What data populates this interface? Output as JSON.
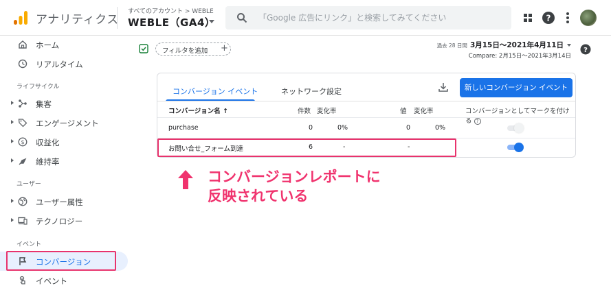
{
  "header": {
    "app_name": "アナリティクス",
    "account_path": "すべてのアカウント > WEBLE",
    "property_name": "WEBLE（GA4）",
    "search_placeholder": "「Google 広告にリンク」と検索してみてください",
    "icons": [
      "apps-grid-icon",
      "help-icon",
      "more-vert-icon",
      "avatar"
    ]
  },
  "sidebar": {
    "items": [
      {
        "label": "ホーム",
        "icon": "home-icon"
      },
      {
        "label": "リアルタイム",
        "icon": "clock-icon"
      }
    ],
    "section_lifecycle": "ライフサイクル",
    "lifecycle_items": [
      {
        "label": "集客",
        "icon": "acquisition-icon"
      },
      {
        "label": "エンゲージメント",
        "icon": "engagement-tag-icon"
      },
      {
        "label": "収益化",
        "icon": "dollar-circle-icon"
      },
      {
        "label": "維持率",
        "icon": "retention-icon"
      }
    ],
    "section_user": "ユーザー",
    "user_items": [
      {
        "label": "ユーザー属性",
        "icon": "globe-icon"
      },
      {
        "label": "テクノロジー",
        "icon": "devices-icon"
      }
    ],
    "section_event": "イベント",
    "event_items": [
      {
        "label": "コンバージョン",
        "icon": "flag-icon",
        "active": true
      },
      {
        "label": "イベント",
        "icon": "touch-icon"
      }
    ]
  },
  "toolbar": {
    "filter_label": "フィルタを追加",
    "date_range_small": "過去 28 日間",
    "date_range": "3月15日～2021年4月11日",
    "compare": "Compare: 2月15日～2021年3月14日"
  },
  "card": {
    "tabs": [
      "コンバージョン イベント",
      "ネットワーク設定"
    ],
    "new_button": "新しいコンバージョン イベント",
    "columns": {
      "name": "コンバージョン名",
      "count": "件数",
      "change1": "変化率",
      "value": "値",
      "change2": "変化率",
      "mark": "コンバージョンとしてマークを付ける"
    },
    "rows": [
      {
        "name": "purchase",
        "count": "0",
        "change1": "0%",
        "value": "0",
        "change2": "0%",
        "marked": false
      },
      {
        "name": "お問い合せ_フォーム到達",
        "count": "6",
        "change1": "-",
        "value": "-",
        "change2": "",
        "marked": true
      }
    ]
  },
  "callout": {
    "line1": "コンバージョンレポートに",
    "line2": "反映されている",
    "color": "#f0336e"
  },
  "colors": {
    "accent": "#1a73e8",
    "highlight": "#e8336d",
    "logo_orange": "#f9ab00",
    "logo_dark_orange": "#e37400"
  }
}
